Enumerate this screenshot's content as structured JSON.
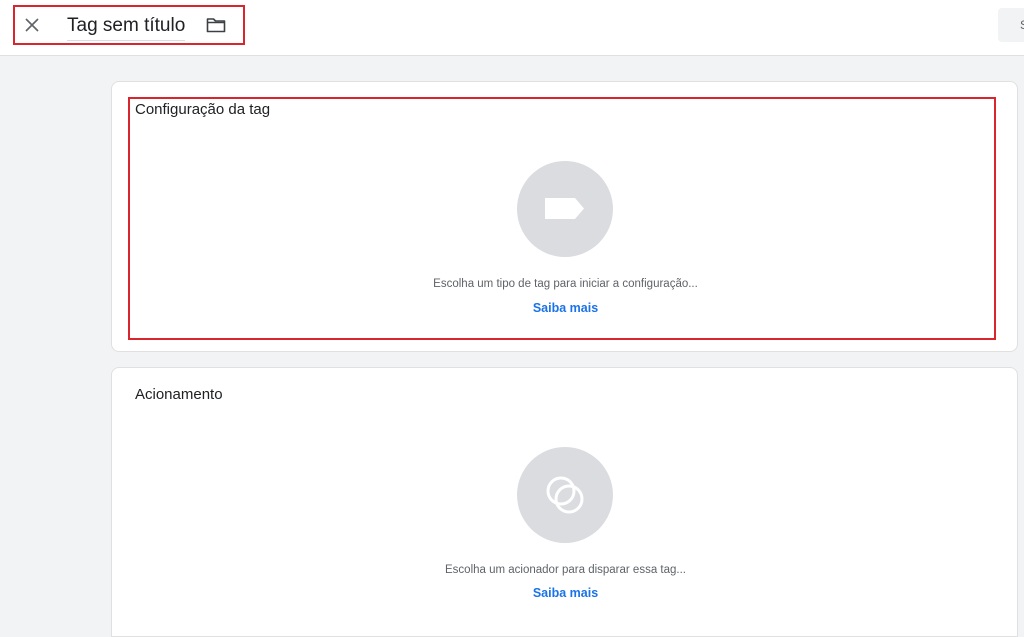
{
  "header": {
    "title": "Tag sem título",
    "save_label": "Salvar"
  },
  "tag_config": {
    "title": "Configuração da tag",
    "hint": "Escolha um tipo de tag para iniciar a configuração...",
    "learn_more": "Saiba mais",
    "icon": "tag-icon"
  },
  "trigger": {
    "title": "Acionamento",
    "hint": "Escolha um acionador para disparar essa tag...",
    "learn_more": "Saiba mais",
    "icon": "trigger-icon"
  },
  "colors": {
    "highlight": "#d9262e",
    "link": "#1a73e8",
    "placeholder": "#dadce0",
    "background": "#f1f3f4"
  }
}
